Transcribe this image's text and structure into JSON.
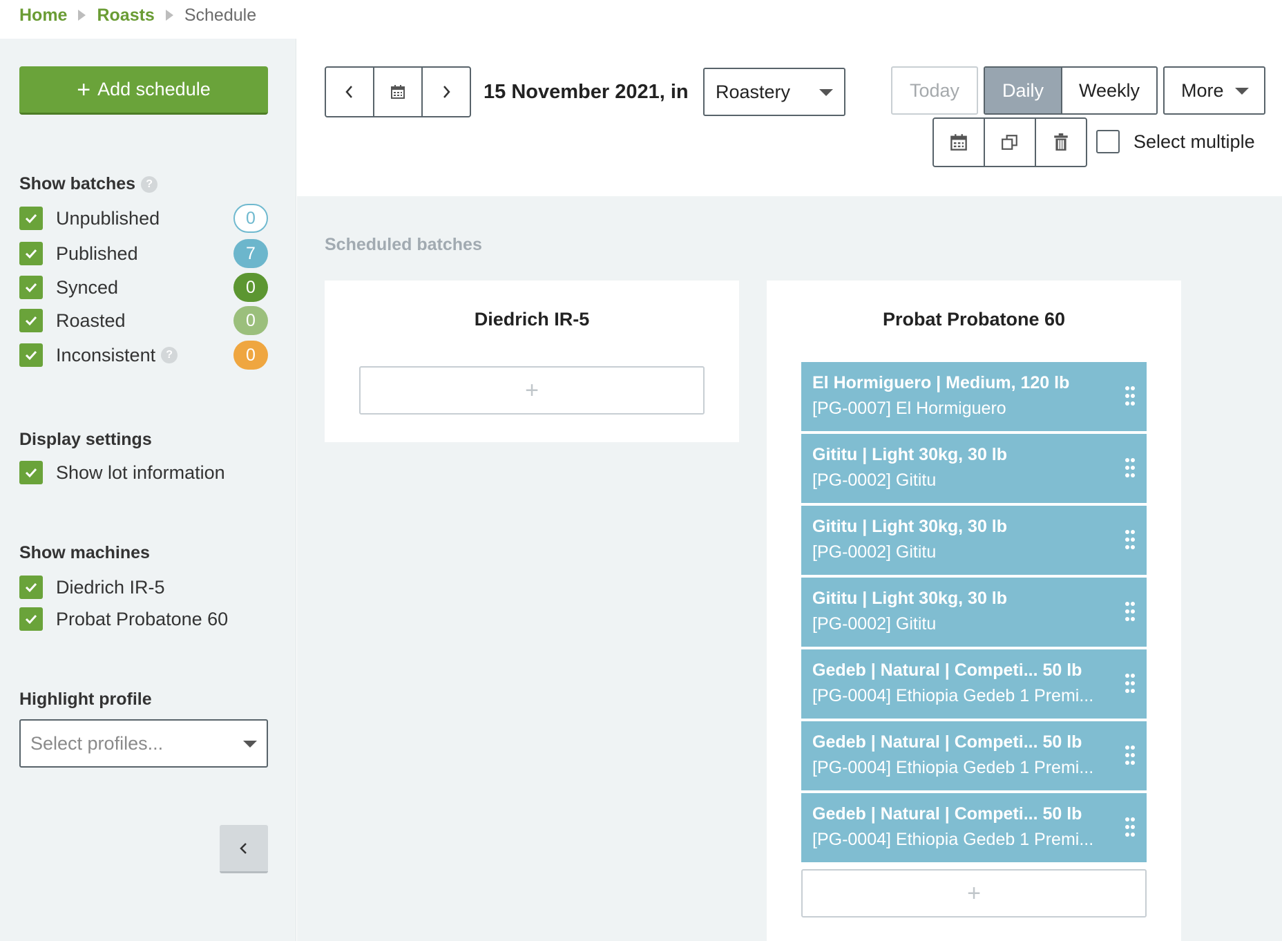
{
  "breadcrumb": {
    "home": "Home",
    "roasts": "Roasts",
    "current": "Schedule"
  },
  "sidebar": {
    "add_schedule_label": "Add schedule",
    "show_batches": {
      "title": "Show batches",
      "items": [
        {
          "label": "Unpublished",
          "count": "0",
          "checked": true
        },
        {
          "label": "Published",
          "count": "7",
          "checked": true
        },
        {
          "label": "Synced",
          "count": "0",
          "checked": true
        },
        {
          "label": "Roasted",
          "count": "0",
          "checked": true
        },
        {
          "label": "Inconsistent",
          "count": "0",
          "checked": true
        }
      ]
    },
    "display_settings": {
      "title": "Display settings",
      "show_lot_information": "Show lot information"
    },
    "show_machines": {
      "title": "Show machines",
      "items": [
        {
          "label": "Diedrich IR-5",
          "checked": true
        },
        {
          "label": "Probat Probatone 60",
          "checked": true
        }
      ]
    },
    "highlight_profile": {
      "title": "Highlight profile",
      "placeholder": "Select profiles..."
    }
  },
  "toolbar": {
    "date_title": "15 November 2021, in",
    "location_value": "Roastery",
    "today_label": "Today",
    "daily_label": "Daily",
    "weekly_label": "Weekly",
    "more_label": "More",
    "select_multiple_label": "Select multiple"
  },
  "main": {
    "title": "Scheduled batches",
    "machines": [
      {
        "name": "Diedrich IR-5",
        "batches": []
      },
      {
        "name": "Probat Probatone 60",
        "batches": [
          {
            "title": "El Hormiguero | Medium, 120 lb",
            "subtitle": "[PG-0007] El Hormiguero"
          },
          {
            "title": "Gititu | Light 30kg, 30 lb",
            "subtitle": "[PG-0002] Gititu"
          },
          {
            "title": "Gititu | Light 30kg, 30 lb",
            "subtitle": "[PG-0002] Gititu"
          },
          {
            "title": "Gititu | Light 30kg, 30 lb",
            "subtitle": "[PG-0002] Gititu"
          },
          {
            "title": "Gedeb | Natural | Competi... 50 lb",
            "subtitle": "[PG-0004] Ethiopia Gedeb 1 Premi..."
          },
          {
            "title": "Gedeb | Natural | Competi... 50 lb",
            "subtitle": "[PG-0004] Ethiopia Gedeb 1 Premi..."
          },
          {
            "title": "Gedeb | Natural | Competi... 50 lb",
            "subtitle": "[PG-0004] Ethiopia Gedeb 1 Premi..."
          }
        ]
      }
    ],
    "add_slot_symbol": "+"
  },
  "colors": {
    "accent_green": "#6aa33a",
    "batch_blue": "#80bdd1",
    "background": "#eff3f4"
  }
}
